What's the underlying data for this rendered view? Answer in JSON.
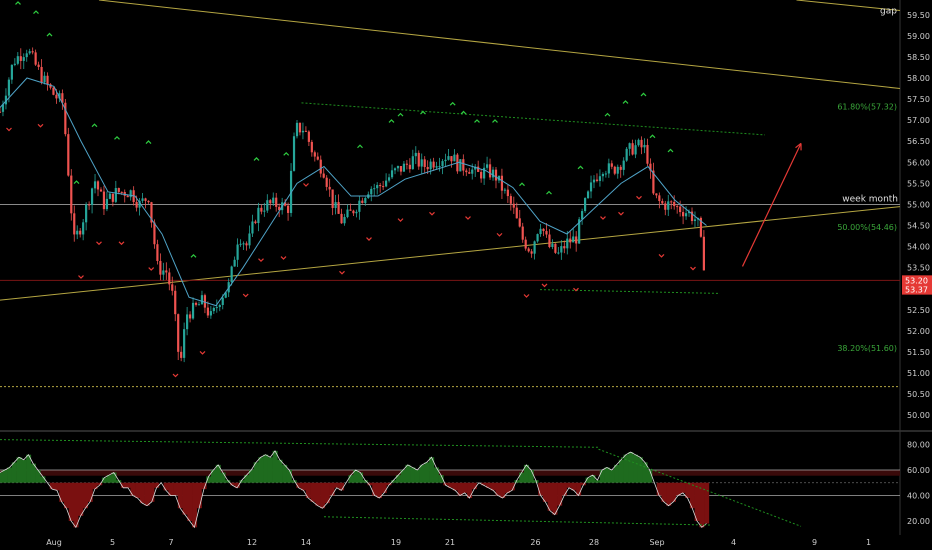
{
  "colors": {
    "background": "#000000",
    "up": "#26a69a",
    "down": "#ef5350",
    "ma": "#4fa3c7",
    "yellow": "#b5a642",
    "green": "#1f8f1f",
    "signal": "#2ecc40",
    "signal_down": "#e53935",
    "hline": "#8a8a8a",
    "hist_pos": "#1e6b1e",
    "hist_neg": "#7a1010",
    "osc_line": "#dddddd",
    "price_tag": "#e53935",
    "axis_text": "#cfcfcf",
    "arrow": "#e53935"
  },
  "chart_data": [
    {
      "type": "candlestick",
      "price_axis": {
        "range": [
          49.65,
          59.85
        ],
        "ticks": [
          "50.00",
          "50.50",
          "51.00",
          "51.50",
          "52.00",
          "52.50",
          "53.00",
          "53.50",
          "54.00",
          "54.50",
          "55.00",
          "55.50",
          "56.00",
          "56.50",
          "57.00",
          "57.50",
          "58.00",
          "58.50",
          "59.00",
          "59.50"
        ]
      },
      "price_tags": [
        {
          "label": "53.20",
          "value": 53.2
        },
        {
          "label": "53.37",
          "value": 52.98
        }
      ],
      "time_axis": {
        "range": [
          0,
          100
        ],
        "ticks": [
          {
            "label": "Aug",
            "x": 6
          },
          {
            "label": "5",
            "x": 12.5
          },
          {
            "label": "7",
            "x": 19
          },
          {
            "label": "12",
            "x": 28
          },
          {
            "label": "14",
            "x": 34
          },
          {
            "label": "19",
            "x": 44
          },
          {
            "label": "21",
            "x": 50
          },
          {
            "label": "26",
            "x": 59.5
          },
          {
            "label": "28",
            "x": 66
          },
          {
            "label": "Sep",
            "x": 73
          },
          {
            "label": "4",
            "x": 81.5
          },
          {
            "label": "9",
            "x": 90.5
          },
          {
            "label": "1",
            "x": 96.5
          }
        ]
      },
      "price_path": [
        [
          0,
          57.2
        ],
        [
          1.5,
          58.4
        ],
        [
          3,
          58.7
        ],
        [
          4.2,
          58.2
        ],
        [
          5,
          57.9
        ],
        [
          6,
          57.6
        ],
        [
          7,
          57.4
        ],
        [
          8.2,
          54.1
        ],
        [
          9,
          54.5
        ],
        [
          10.5,
          55.6
        ],
        [
          11.5,
          55.0
        ],
        [
          13,
          55.3
        ],
        [
          14.5,
          55.3
        ],
        [
          15.5,
          55.0
        ],
        [
          16.5,
          55.2
        ],
        [
          17.5,
          53.5
        ],
        [
          18.5,
          53.4
        ],
        [
          19.2,
          52.8
        ],
        [
          20,
          51.1
        ],
        [
          20.7,
          52.4
        ],
        [
          21.5,
          52.5
        ],
        [
          22.5,
          52.7
        ],
        [
          23.5,
          52.3
        ],
        [
          24.5,
          52.8
        ],
        [
          25.5,
          53.1
        ],
        [
          26.5,
          54.3
        ],
        [
          27.5,
          54.0
        ],
        [
          28.5,
          54.8
        ],
        [
          29.5,
          55.0
        ],
        [
          31,
          55.0
        ],
        [
          32,
          54.9
        ],
        [
          32.8,
          56.8
        ],
        [
          33.8,
          56.8
        ],
        [
          35,
          56.1
        ],
        [
          36,
          55.8
        ],
        [
          37,
          55.0
        ],
        [
          38,
          54.6
        ],
        [
          39,
          54.8
        ],
        [
          40,
          55.1
        ],
        [
          41,
          55.4
        ],
        [
          42,
          55.4
        ],
        [
          43,
          55.6
        ],
        [
          44,
          55.8
        ],
        [
          45,
          55.9
        ],
        [
          46,
          56.1
        ],
        [
          47,
          55.9
        ],
        [
          48,
          56.0
        ],
        [
          49,
          56.1
        ],
        [
          50,
          56.2
        ],
        [
          51,
          55.9
        ],
        [
          52,
          55.9
        ],
        [
          53,
          55.7
        ],
        [
          54,
          55.8
        ],
        [
          55,
          55.7
        ],
        [
          56,
          55.3
        ],
        [
          57,
          54.9
        ],
        [
          58,
          54.2
        ],
        [
          59,
          53.9
        ],
        [
          60,
          54.6
        ],
        [
          61,
          54.0
        ],
        [
          62,
          53.8
        ],
        [
          63,
          54.1
        ],
        [
          64,
          54.2
        ],
        [
          65,
          55.0
        ],
        [
          66,
          55.6
        ],
        [
          67,
          55.9
        ],
        [
          68,
          55.8
        ],
        [
          69,
          56.0
        ],
        [
          70,
          56.3
        ],
        [
          70.8,
          56.4
        ],
        [
          71.8,
          56.3
        ],
        [
          72.6,
          55.2
        ],
        [
          73.5,
          55.0
        ],
        [
          74.5,
          55.0
        ],
        [
          75.5,
          54.9
        ],
        [
          76.5,
          54.8
        ],
        [
          77.5,
          54.6
        ],
        [
          78.5,
          53.2
        ]
      ],
      "ma_path": [
        [
          0,
          57.3
        ],
        [
          3,
          58.0
        ],
        [
          6,
          57.8
        ],
        [
          9,
          56.5
        ],
        [
          12,
          55.3
        ],
        [
          15,
          55.2
        ],
        [
          18,
          54.3
        ],
        [
          21,
          52.8
        ],
        [
          24,
          52.6
        ],
        [
          27,
          53.5
        ],
        [
          30,
          54.5
        ],
        [
          33,
          55.5
        ],
        [
          36,
          55.9
        ],
        [
          39,
          55.2
        ],
        [
          42,
          55.2
        ],
        [
          45,
          55.6
        ],
        [
          48,
          55.8
        ],
        [
          51,
          56.0
        ],
        [
          54,
          55.8
        ],
        [
          57,
          55.4
        ],
        [
          60,
          54.6
        ],
        [
          63,
          54.3
        ],
        [
          66,
          54.9
        ],
        [
          69,
          55.5
        ],
        [
          72,
          55.9
        ],
        [
          75,
          55.1
        ],
        [
          78.5,
          54.5
        ]
      ],
      "horizontal_lines": [
        {
          "value": 55.0,
          "label": "week month"
        },
        {
          "value": 50.68,
          "label": ""
        },
        {
          "value": 53.2,
          "label": ""
        }
      ],
      "trend_lines": [
        {
          "from": [
            0,
            52.73
          ],
          "to": [
            100,
            54.95
          ],
          "color": "yellow"
        },
        {
          "from": [
            11,
            59.85
          ],
          "to": [
            100,
            57.75
          ],
          "color": "yellow"
        },
        {
          "from": [
            88.5,
            59.85
          ],
          "to": [
            100,
            59.6
          ],
          "color": "yellow"
        },
        {
          "from": [
            33.5,
            57.41
          ],
          "to": [
            85,
            56.65
          ],
          "color": "green"
        },
        {
          "from": [
            60,
            52.98
          ],
          "to": [
            80,
            52.89
          ],
          "color": "green"
        }
      ],
      "fib_labels": [
        {
          "label": "61.80%(57.32)",
          "value": 57.32
        },
        {
          "label": "50.00%(54.46)",
          "value": 54.46
        },
        {
          "label": "38.20%(51.60)",
          "value": 51.6
        }
      ],
      "annotations": [
        {
          "label": "gap",
          "value": 59.6
        }
      ],
      "arrow": {
        "from": [
          82.5,
          53.53
        ],
        "to": [
          89,
          56.45
        ]
      },
      "signals": [
        {
          "type": "up",
          "x": [
            2,
            4,
            5.5,
            8.5,
            10.5,
            13,
            16.5,
            21.5,
            28.5,
            31.8,
            40,
            43.5,
            44.5,
            47,
            50.3,
            51.5,
            53,
            55,
            58,
            61,
            64.5,
            67.5,
            69.5,
            71.5,
            72.5,
            74.5
          ]
        },
        {
          "type": "down",
          "x": [
            1,
            4.5,
            9,
            11,
            13.5,
            16.8,
            19.5,
            22.5,
            27.3,
            29,
            31.5,
            34,
            38,
            41,
            44.5,
            48,
            52,
            55.5,
            58.5,
            60.5,
            64,
            67,
            69,
            71,
            73.5,
            77
          ]
        }
      ]
    },
    {
      "type": "area",
      "osc_axis": {
        "range": [
          9,
          89
        ],
        "ticks": [
          "20.00",
          "40.00",
          "60.00",
          "80.00"
        ]
      },
      "horizontal_lines": [
        {
          "value": 50.0
        },
        {
          "value": 60.0
        },
        {
          "value": 40.0
        }
      ],
      "band": [
        60,
        55.5
      ],
      "trend_lines": [
        {
          "from": [
            0,
            83.8
          ],
          "to": [
            66.5,
            77.8
          ],
          "color": "green"
        },
        {
          "from": [
            36,
            23.3
          ],
          "to": [
            79,
            16.8
          ],
          "color": "green"
        },
        {
          "from": [
            66.5,
            76.3
          ],
          "to": [
            89,
            15.8
          ],
          "color": "green"
        }
      ],
      "series": [
        {
          "values": [
            58,
            60,
            62,
            66,
            70,
            68,
            72,
            65,
            60,
            55,
            50,
            45,
            44,
            35,
            30,
            20,
            15,
            24,
            30,
            35,
            45,
            48,
            54,
            56,
            58,
            52,
            46,
            46,
            40,
            38,
            34,
            32,
            35,
            46,
            50,
            44,
            40,
            40,
            30,
            25,
            20,
            15,
            30,
            45,
            55,
            60,
            64,
            58,
            52,
            48,
            46,
            52,
            56,
            60,
            66,
            70,
            72,
            70,
            75,
            68,
            64,
            60,
            52,
            46,
            44,
            38,
            35,
            32,
            30,
            34,
            40,
            46,
            44,
            50,
            56,
            60,
            58,
            52,
            48,
            40,
            38,
            42,
            48,
            52,
            56,
            60,
            64,
            62,
            60,
            64,
            66,
            70,
            62,
            56,
            48,
            46,
            44,
            40,
            42,
            38,
            45,
            50,
            48,
            46,
            44,
            40,
            38,
            42,
            44,
            52,
            58,
            64,
            60,
            52,
            40,
            35,
            28,
            25,
            32,
            40,
            46,
            44,
            40,
            48,
            54,
            56,
            52,
            60,
            62,
            60,
            64,
            68,
            72,
            74,
            72,
            70,
            66,
            60,
            50,
            40,
            35,
            32,
            35,
            40,
            42,
            38,
            30,
            20,
            15,
            18
          ]
        }
      ]
    }
  ]
}
